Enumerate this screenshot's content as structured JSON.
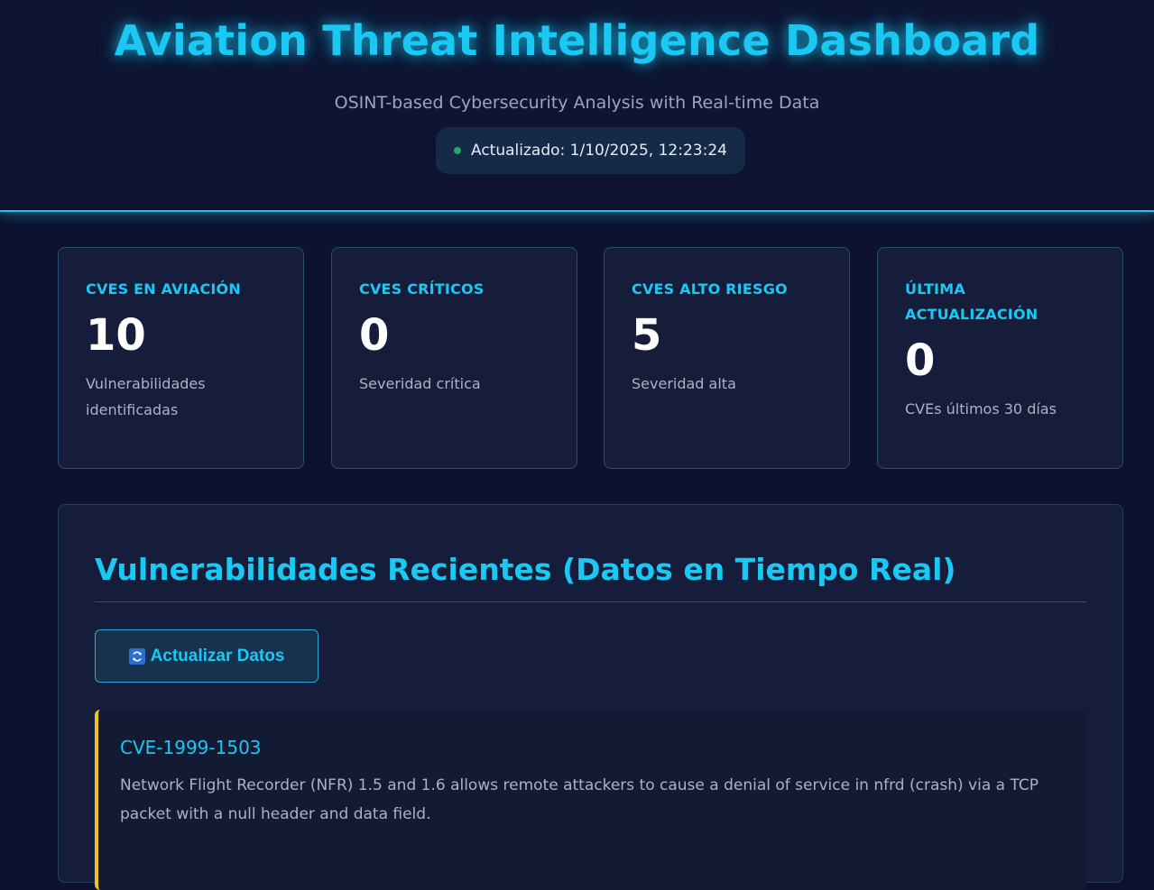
{
  "header": {
    "title": "Aviation Threat Intelligence Dashboard",
    "subtitle": "OSINT-based Cybersecurity Analysis with Real-time Data",
    "updated": "Actualizado: 1/10/2025, 12:23:24"
  },
  "stats": [
    {
      "label": "CVES EN AVIACIÓN",
      "value": "10",
      "desc": "Vulnerabilidades identificadas"
    },
    {
      "label": "CVES CRÍTICOS",
      "value": "0",
      "desc": "Severidad crítica"
    },
    {
      "label": "CVES ALTO RIESGO",
      "value": "5",
      "desc": "Severidad alta"
    },
    {
      "label": "ÚLTIMA ACTUALIZACIÓN",
      "value": "0",
      "desc": "CVEs últimos 30 días"
    }
  ],
  "vulns_section": {
    "title": "Vulnerabilidades Recientes (Datos en Tiempo Real)",
    "refresh_label": "Actualizar Datos",
    "items": [
      {
        "id": "CVE-1999-1503",
        "description": "Network Flight Recorder (NFR) 1.5 and 1.6 allows remote attackers to cause a denial of service in nfrd (crash) via a TCP packet with a null header and data field."
      }
    ]
  },
  "colors": {
    "background": "#0d1230",
    "accent": "#19c8f3",
    "card": "#161d3a",
    "status_ok": "#2fa564",
    "severity_high": "#f0c419"
  },
  "icons": {
    "status": "status-dot-icon",
    "refresh": "refresh-icon"
  }
}
